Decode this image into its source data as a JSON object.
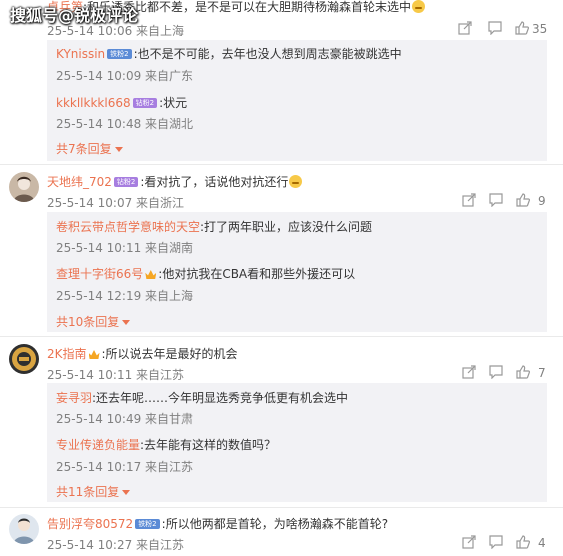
{
  "watermark": "搜狐号@锐极评论",
  "c1": {
    "user": "卓兵第",
    "text": ":和乐透秀比都不差，是不是可以在大胆期待杨瀚森首轮末选中",
    "time": "25-5-14 10:06 来自上海",
    "likes": "35",
    "replies": [
      {
        "user": "KYnissin",
        "badge": "铁粉2",
        "text": ":也不是不可能，去年也没人想到周志豪能被跳选中",
        "time": "25-5-14 10:09 来自广东"
      },
      {
        "user": "kkkllkkkl668",
        "badge": "钻粉2",
        "text": ":状元",
        "time": "25-5-14 10:48 来自湖北"
      }
    ],
    "more": "共7条回复"
  },
  "c2": {
    "user": "天地纬_702",
    "badge": "钻粉2",
    "text": ":看对抗了，话说他对抗还行",
    "time": "25-5-14 10:07 来自浙江",
    "likes": "9",
    "replies": [
      {
        "user": "卷积云带点哲学意味的天空",
        "text": ":打了两年职业，应该没什么问题",
        "time": "25-5-14 10:11 来自湖南"
      },
      {
        "user": "查理十字街66号",
        "text": ":他对抗我在CBA看和那些外援还可以",
        "time": "25-5-14 12:19 来自上海"
      }
    ],
    "more": "共10条回复"
  },
  "c3": {
    "user": "2K指南",
    "text": ":所以说去年是最好的机会",
    "time": "25-5-14 10:11 来自江苏",
    "likes": "7",
    "replies": [
      {
        "user": "妄寻羽",
        "text": ":还去年呢……今年明显选秀竞争低更有机会选中",
        "time": "25-5-14 10:49 来自甘肃"
      },
      {
        "user": "专业传递负能量",
        "text": ":去年能有这样的数值吗？",
        "time": "25-5-14 10:17 来自江苏"
      }
    ],
    "more": "共11条回复"
  },
  "c4": {
    "user": "告别浮夸80572",
    "badge": "铁粉2",
    "text": ":所以他两都是首轮，为啥杨瀚森不能首轮?",
    "time": "25-5-14 10:27 来自江苏",
    "likes": "4"
  },
  "colors": {
    "username": "#eb7350",
    "reply_bg": "#f2f2f5",
    "meta": "#808080"
  }
}
